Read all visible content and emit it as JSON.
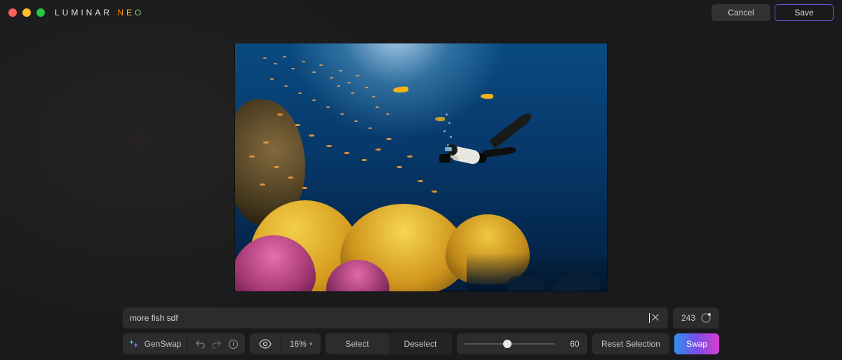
{
  "app": {
    "name": "LUMINAR",
    "suffix": "NEO"
  },
  "header": {
    "cancel": "Cancel",
    "save": "Save"
  },
  "prompt": {
    "value": "more fish sdf",
    "counter": "243"
  },
  "toolbar": {
    "genswap": "GenSwap",
    "zoom": "16%",
    "select": "Select",
    "deselect": "Deselect",
    "slider_value": "60",
    "reset": "Reset Selection",
    "swap": "Swap"
  },
  "slider": {
    "percent": 48
  },
  "colors": {
    "accent_border": "#6a5acd"
  }
}
